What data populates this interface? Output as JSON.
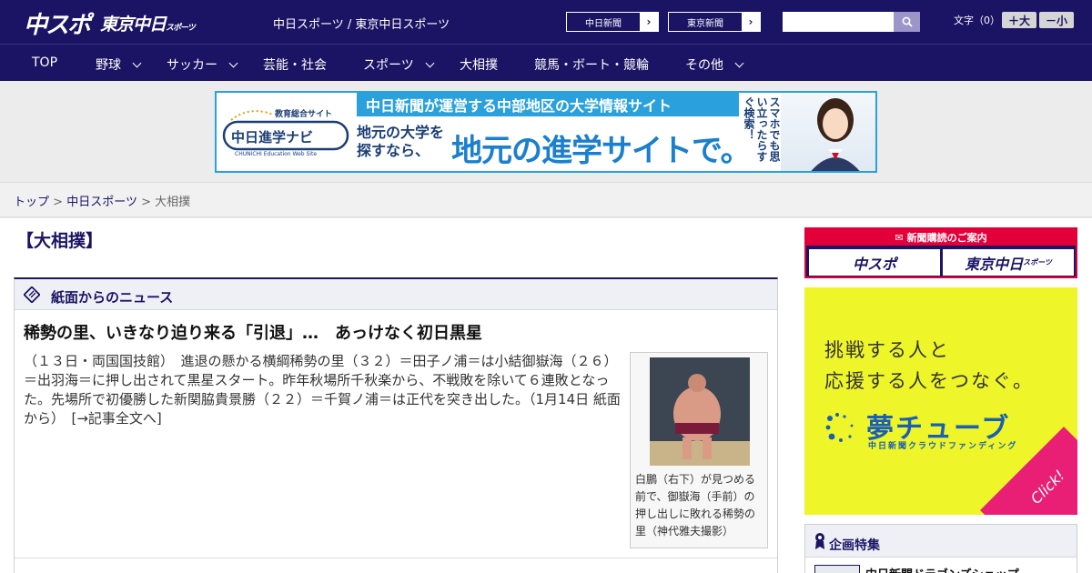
{
  "header": {
    "logo_chuspo": "中スポ",
    "logo_tokyo": "東京中日",
    "logo_tokyo_small": "スポーツ",
    "site_title": "中日スポーツ / 東京中日スポーツ",
    "link_chunichi": "中日新聞",
    "link_tokyo": "東京新聞",
    "search_placeholder": "",
    "font_size_label": "文字（0）",
    "font_bigger": "＋大",
    "font_smaller": "－小"
  },
  "nav": {
    "items": [
      {
        "label": "TOP"
      },
      {
        "label": "野球"
      },
      {
        "label": "サッカー"
      },
      {
        "label": "芸能・社会"
      },
      {
        "label": "スポーツ"
      },
      {
        "label": "大相撲"
      },
      {
        "label": "競馬・ボート・競輪"
      },
      {
        "label": "その他"
      }
    ]
  },
  "banner": {
    "top_line": "中日新聞が運営する中部地区の大学情報サイト",
    "left_line1": "地元の大学を",
    "left_line2": "探すなら、",
    "big_line": "地元の進学サイトで。",
    "vertical_text": "スマホでも思い立ったらすぐ検索！",
    "logo_small": "教育総合サイト",
    "logo_main": "中日進学ナビ",
    "logo_en": "CHUNICHI Education Web Site"
  },
  "breadcrumb": {
    "top": "トップ",
    "sep": ">",
    "section": "中日スポーツ",
    "current": "大相撲"
  },
  "page": {
    "title": "【大相撲】"
  },
  "news": {
    "panel_title": "紙面からのニュース",
    "article_title": "稀勢の里、いきなり迫り来る「引退」…　あっけなく初日黒星",
    "article_body": "（１３日・両国国技館）　進退の懸かる横綱稀勢の里（３２）＝田子ノ浦＝は小結御嶽海（２６）＝出羽海＝に押し出されて黒星スタート。昨年秋場所千秋楽から、不戦敗を除いて６連敗となった。先場所で初優勝した新関脇貴景勝（２２）＝千賀ノ浦＝は正代を突き出した。（1月14日 紙面から）　",
    "more_link": "[→記事全文へ]",
    "photo_caption": "白鵬（右下）が見つめる前で、御嶽海（手前）の押し出しに敗れる稀勢の里（神代雅夫撮影）"
  },
  "sidebar": {
    "subscribe_head": "新聞購読のご案内",
    "sub_chuspo": "中スポ",
    "sub_tokyo": "東京中日",
    "sub_tokyo_small": "スポーツ",
    "ad_line1": "挑戦する人と",
    "ad_line2": "応援する人をつなぐ。",
    "ad_logo": "夢チューブ",
    "ad_logo_sub": "中日新聞クラウドファンディング",
    "ad_click": "Click!",
    "feature_title": "企画特集",
    "feature_item": "中日新聞ドラゴンズショップ"
  },
  "colors": {
    "brand_navy": "#1b1464",
    "accent_red": "#e3003a",
    "banner_blue": "#2aa1dc",
    "ad_yellow": "#eef529",
    "ad_pink": "#e91e75"
  }
}
